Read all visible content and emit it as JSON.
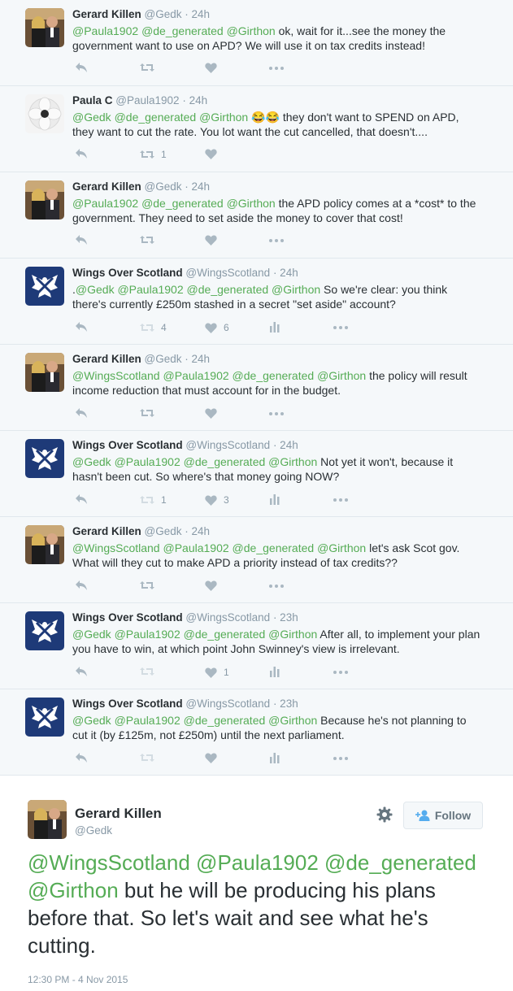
{
  "tweets": [
    {
      "author": "Gerard Killen",
      "handle": "@Gedk",
      "time": "· 24h",
      "mentions": [
        "@Paula1902",
        "@de_generated",
        "@Girthon"
      ],
      "text": " ok, wait for it...see the money the government want to use on APD? We will use it on tax credits instead!",
      "retweets": "",
      "likes": ""
    },
    {
      "author": "Paula C",
      "handle": "@Paula1902",
      "time": "· 24h",
      "mentions": [
        "@Gedk",
        "@de_generated",
        "@Girthon"
      ],
      "text": " 😂😂 they don't want to SPEND on APD, they want to cut the rate. You lot want the cut cancelled, that doesn't....",
      "retweets": "1",
      "likes": ""
    },
    {
      "author": "Gerard Killen",
      "handle": "@Gedk",
      "time": "· 24h",
      "mentions": [
        "@Paula1902",
        "@de_generated",
        "@Girthon"
      ],
      "text": " the APD policy comes at a *cost* to the government. They need to set aside the money to cover that cost!",
      "retweets": "",
      "likes": ""
    },
    {
      "author": "Wings Over Scotland",
      "handle": "@WingsScotland",
      "time": "· 24h",
      "prefix": ".",
      "mentions": [
        "@Gedk",
        "@Paula1902",
        "@de_generated",
        "@Girthon"
      ],
      "text": " So we're clear: you think there's currently £250m stashed in a secret \"set aside\" account?",
      "retweets": "4",
      "likes": "6"
    },
    {
      "author": "Gerard Killen",
      "handle": "@Gedk",
      "time": "· 24h",
      "mentions": [
        "@WingsScotland",
        "@Paula1902",
        "@de_generated",
        "@Girthon"
      ],
      "text": " the policy will result income reduction that must account for in the budget.",
      "retweets": "",
      "likes": ""
    },
    {
      "author": "Wings Over Scotland",
      "handle": "@WingsScotland",
      "time": "· 24h",
      "mentions": [
        "@Gedk",
        "@Paula1902",
        "@de_generated",
        "@Girthon"
      ],
      "text": " Not yet it won't, because it hasn't been cut. So where's that money going NOW?",
      "retweets": "1",
      "likes": "3"
    },
    {
      "author": "Gerard Killen",
      "handle": "@Gedk",
      "time": "· 24h",
      "mentions": [
        "@WingsScotland",
        "@Paula1902",
        "@de_generated",
        "@Girthon"
      ],
      "text": " let's ask Scot gov. What will they cut to make APD a priority instead of tax credits??",
      "retweets": "",
      "likes": ""
    },
    {
      "author": "Wings Over Scotland",
      "handle": "@WingsScotland",
      "time": "· 23h",
      "mentions": [
        "@Gedk",
        "@Paula1902",
        "@de_generated",
        "@Girthon"
      ],
      "text": " After all, to implement your plan you have to win, at which point John Swinney's view is irrelevant.",
      "retweets": "",
      "likes": "1"
    },
    {
      "author": "Wings Over Scotland",
      "handle": "@WingsScotland",
      "time": "· 23h",
      "mentions": [
        "@Gedk",
        "@Paula1902",
        "@de_generated",
        "@Girthon"
      ],
      "text": " Because he's not planning to cut it (by £125m, not £250m) until the next parliament.",
      "retweets": "",
      "likes": ""
    }
  ],
  "focus": {
    "author": "Gerard Killen",
    "handle": "@Gedk",
    "follow_label": "Follow",
    "mentions": [
      "@WingsScotland",
      "@Paula1902",
      "@de_generated",
      "@Girthon"
    ],
    "text": " but he will be producing his plans before that. So let's wait and see what he's cutting.",
    "timestamp": "12:30 PM - 4 Nov 2015"
  },
  "colors": {
    "mention": "#55ac55",
    "muted": "#8899a6",
    "icon": "#aab8c2",
    "border": "#e1e8ed"
  }
}
